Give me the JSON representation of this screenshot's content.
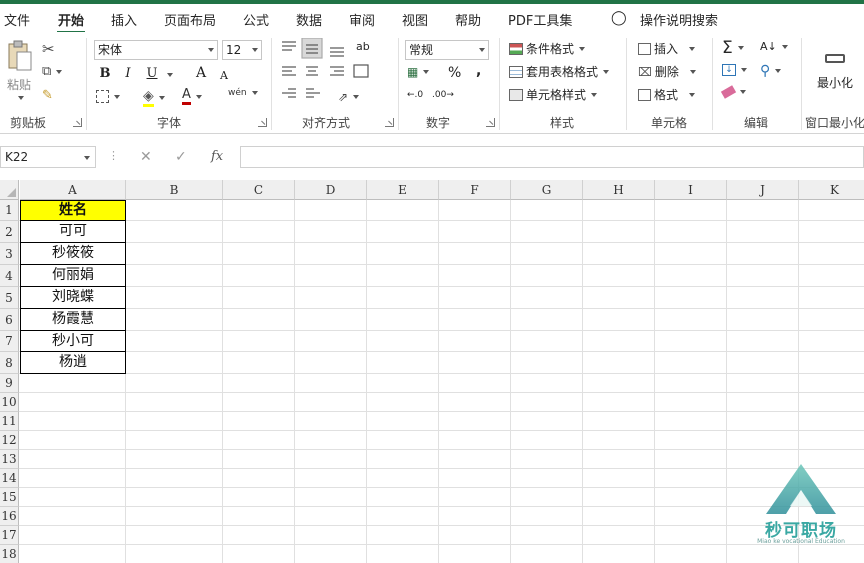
{
  "ribbon_tabs": [
    "文件",
    "开始",
    "插入",
    "页面布局",
    "公式",
    "数据",
    "审阅",
    "视图",
    "帮助",
    "PDF工具集"
  ],
  "active_tab": "开始",
  "tell_me": "操作说明搜索",
  "clipboard": {
    "paste_label": "粘贴",
    "group_label": "剪贴板"
  },
  "font": {
    "name": "宋体",
    "size": "12",
    "group_label": "字体",
    "bold": "B",
    "italic": "I",
    "underline": "U",
    "grow": "A",
    "shrink": "A",
    "phonetic": "wén"
  },
  "alignment": {
    "group_label": "对齐方式"
  },
  "number": {
    "format": "常规",
    "group_label": "数字",
    "percent": "%",
    "comma": ","
  },
  "styles": {
    "conditional": "条件格式",
    "table": "套用表格格式",
    "cell_styles": "单元格样式",
    "group_label": "样式"
  },
  "cells": {
    "insert": "插入",
    "delete": "删除",
    "format": "格式",
    "group_label": "单元格"
  },
  "editing": {
    "group_label": "编辑"
  },
  "window": {
    "minimize": "最小化",
    "group_label": "窗口最小化"
  },
  "formula_bar": {
    "name_box": "K22",
    "fx": "fx",
    "value": ""
  },
  "columns": [
    "A",
    "B",
    "C",
    "D",
    "E",
    "F",
    "G",
    "H",
    "I",
    "J",
    "K"
  ],
  "rows": [
    "1",
    "2",
    "3",
    "4",
    "5",
    "6",
    "7",
    "8",
    "9",
    "10",
    "11",
    "12",
    "13",
    "14",
    "15",
    "16",
    "17",
    "18"
  ],
  "table": {
    "header": "姓名",
    "names": [
      "可可",
      "秒筱筱",
      "何丽娟",
      "刘晓蝶",
      "杨霞慧",
      "秒小可",
      "杨逍"
    ]
  },
  "watermark": {
    "brand": "秒可职场",
    "sub": "Miao ke vocational Education"
  },
  "colors": {
    "accent": "#217346",
    "header_fill": "#ffff00",
    "watermark": "#3aa8a3"
  }
}
